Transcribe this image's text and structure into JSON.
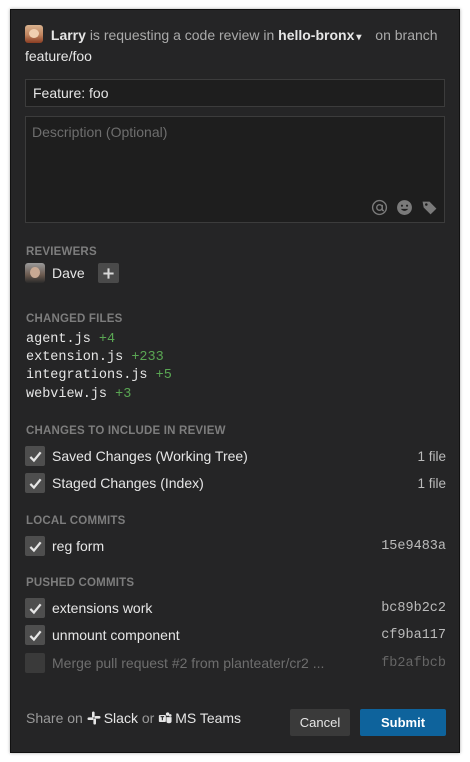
{
  "header": {
    "requester": "Larry",
    "text_requesting": "is requesting a code review in",
    "repo": "hello-bronx",
    "text_on_branch": "on branch",
    "branch": "feature/foo"
  },
  "form": {
    "title_value": "Feature: foo",
    "description_placeholder": "Description (Optional)"
  },
  "reviewers": {
    "section_title": "REVIEWERS",
    "items": [
      {
        "name": "Dave"
      }
    ]
  },
  "changed_files": {
    "section_title": "CHANGED FILES",
    "items": [
      {
        "file": "agent.js",
        "delta": "+4"
      },
      {
        "file": "extension.js",
        "delta": "+233"
      },
      {
        "file": "integrations.js",
        "delta": "+5"
      },
      {
        "file": "webview.js",
        "delta": "+3"
      }
    ]
  },
  "changes_to_include": {
    "section_title": "CHANGES TO INCLUDE IN REVIEW",
    "items": [
      {
        "label": "Saved Changes (Working Tree)",
        "meta": "1 file",
        "checked": true
      },
      {
        "label": "Staged Changes (Index)",
        "meta": "1 file",
        "checked": true
      }
    ]
  },
  "local_commits": {
    "section_title": "LOCAL COMMITS",
    "items": [
      {
        "label": "reg form",
        "sha": "15e9483a",
        "checked": true
      }
    ]
  },
  "pushed_commits": {
    "section_title": "PUSHED COMMITS",
    "items": [
      {
        "label": "extensions work",
        "sha": "bc89b2c2",
        "checked": true
      },
      {
        "label": "unmount component",
        "sha": "cf9ba117",
        "checked": true
      },
      {
        "label": "Merge pull request #2 from planteater/cr2 ...",
        "sha": "fb2afbcb",
        "checked": false
      }
    ]
  },
  "footer": {
    "share_on": "Share on",
    "slack": "Slack",
    "or": "or",
    "ms_teams": "MS Teams",
    "cancel_label": "Cancel",
    "submit_label": "Submit"
  },
  "colors": {
    "background": "#252526",
    "added_lines": "#5aa653",
    "submit_button": "#0e639c"
  }
}
